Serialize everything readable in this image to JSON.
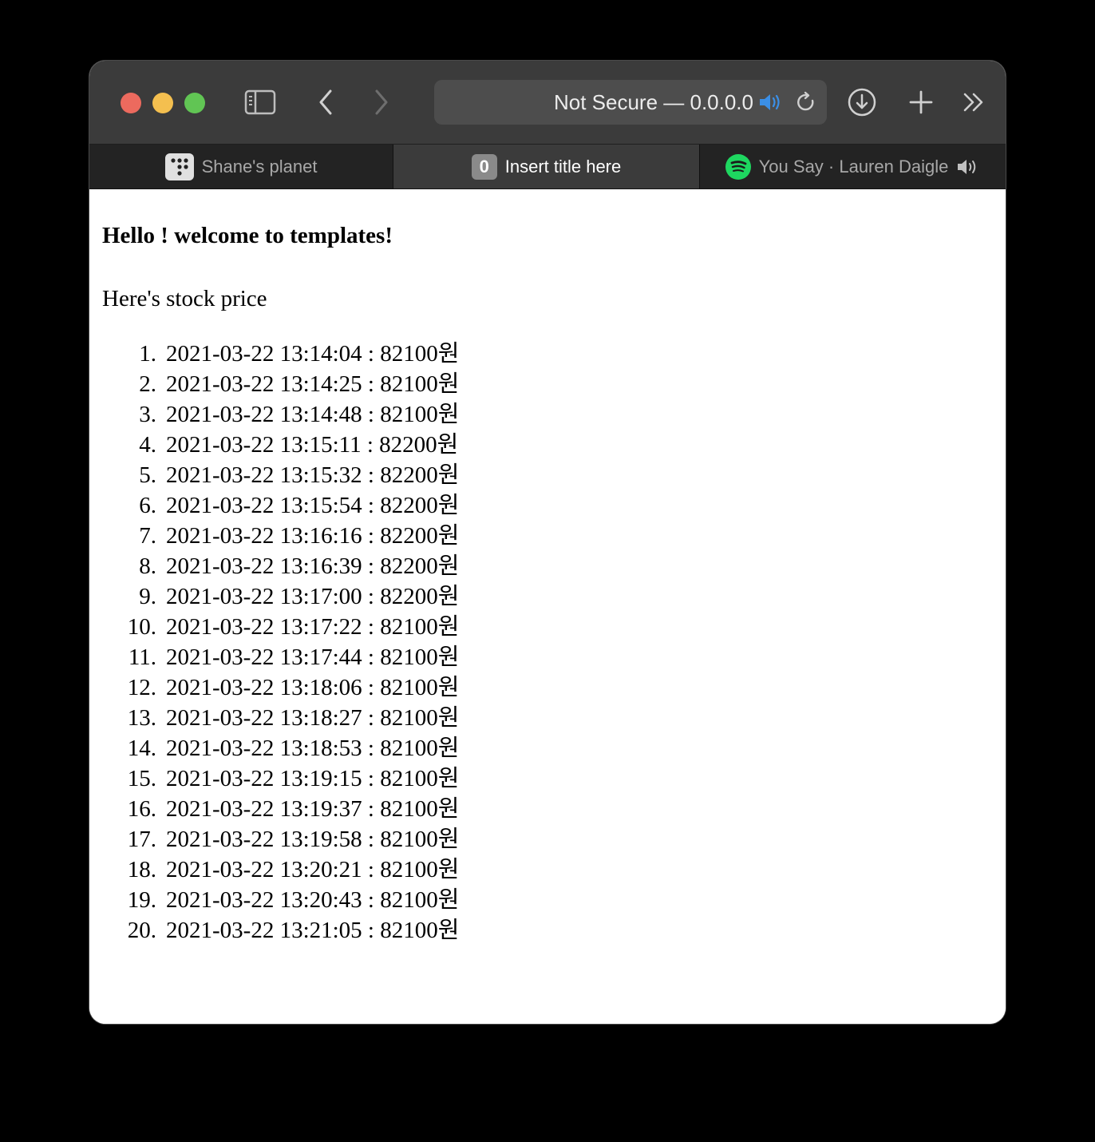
{
  "browser": {
    "address": "Not Secure — 0.0.0.0",
    "tabs": [
      {
        "label": "Shane's planet",
        "active": false
      },
      {
        "label": "Insert title here",
        "active": true,
        "favicon_text": "0"
      },
      {
        "label": "You Say · Lauren Daigle",
        "active": false,
        "playing_audio": true
      }
    ],
    "colors": {
      "close": "#ec6a5e",
      "minimize": "#f4bf4f",
      "maximize": "#61c554",
      "audio_accent": "#3b8fe6",
      "spotify": "#1ed760"
    }
  },
  "page": {
    "heading": "Hello ! welcome to templates!",
    "subtitle": "Here's stock price",
    "items": [
      {
        "num": "1.",
        "text": "2021-03-22 13:14:04 : 82100원"
      },
      {
        "num": "2.",
        "text": "2021-03-22 13:14:25 : 82100원"
      },
      {
        "num": "3.",
        "text": "2021-03-22 13:14:48 : 82100원"
      },
      {
        "num": "4.",
        "text": "2021-03-22 13:15:11 : 82200원"
      },
      {
        "num": "5.",
        "text": "2021-03-22 13:15:32 : 82200원"
      },
      {
        "num": "6.",
        "text": "2021-03-22 13:15:54 : 82200원"
      },
      {
        "num": "7.",
        "text": "2021-03-22 13:16:16 : 82200원"
      },
      {
        "num": "8.",
        "text": "2021-03-22 13:16:39 : 82200원"
      },
      {
        "num": "9.",
        "text": "2021-03-22 13:17:00 : 82200원"
      },
      {
        "num": "10.",
        "text": "2021-03-22 13:17:22 : 82100원"
      },
      {
        "num": "11.",
        "text": "2021-03-22 13:17:44 : 82100원"
      },
      {
        "num": "12.",
        "text": "2021-03-22 13:18:06 : 82100원"
      },
      {
        "num": "13.",
        "text": "2021-03-22 13:18:27 : 82100원"
      },
      {
        "num": "14.",
        "text": "2021-03-22 13:18:53 : 82100원"
      },
      {
        "num": "15.",
        "text": "2021-03-22 13:19:15 : 82100원"
      },
      {
        "num": "16.",
        "text": "2021-03-22 13:19:37 : 82100원"
      },
      {
        "num": "17.",
        "text": "2021-03-22 13:19:58 : 82100원"
      },
      {
        "num": "18.",
        "text": "2021-03-22 13:20:21 : 82100원"
      },
      {
        "num": "19.",
        "text": "2021-03-22 13:20:43 : 82100원"
      },
      {
        "num": "20.",
        "text": "2021-03-22 13:21:05 : 82100원"
      }
    ]
  }
}
